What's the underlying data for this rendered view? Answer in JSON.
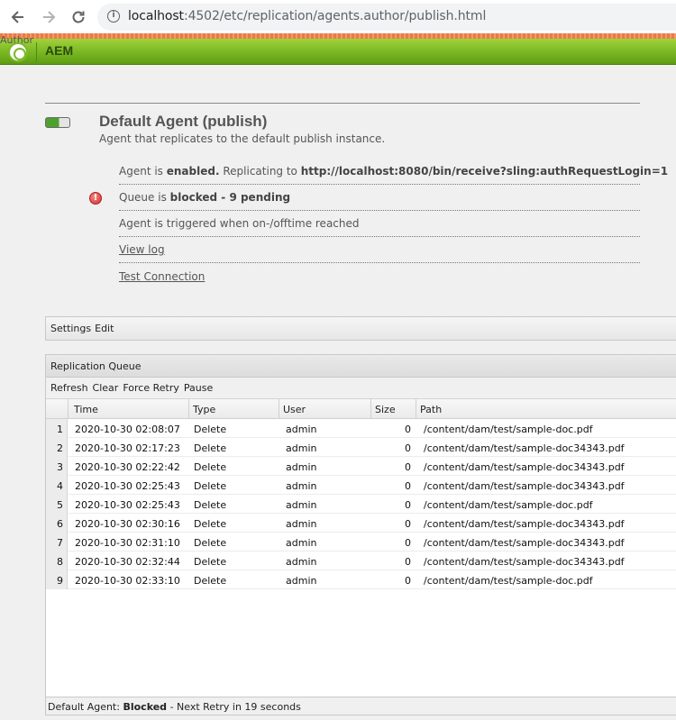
{
  "browser": {
    "url_host": "localhost",
    "url_rest": ":4502/etc/replication/agents.author/publish.html"
  },
  "header": {
    "author_label": "Author",
    "app_name": "AEM",
    "accent_color": "#7ab72b"
  },
  "agent": {
    "title": "Default Agent (publish)",
    "description": "Agent that replicates to the default publish instance.",
    "status_prefix": "Agent is",
    "status_value": "enabled.",
    "replicating_prefix": "Replicating to",
    "replicating_url": "http://localhost:8080/bin/receive?sling:authRequestLogin=1",
    "queue_prefix": "Queue is",
    "queue_value": "blocked - 9 pending",
    "trigger_text": "Agent is triggered when on-/offtime reached",
    "view_log": "View log",
    "test_connection": "Test Connection"
  },
  "settings": {
    "label": "Settings",
    "edit": "Edit"
  },
  "queue": {
    "title": "Replication Queue",
    "toolbar": {
      "refresh": "Refresh",
      "clear": "Clear",
      "force_retry": "Force Retry",
      "pause": "Pause"
    },
    "columns": {
      "time": "Time",
      "type": "Type",
      "user": "User",
      "size": "Size",
      "path": "Path"
    },
    "rows": [
      {
        "n": "1",
        "time": "2020-10-30 02:08:07",
        "type": "Delete",
        "user": "admin",
        "size": "0",
        "path": "/content/dam/test/sample-doc.pdf"
      },
      {
        "n": "2",
        "time": "2020-10-30 02:17:23",
        "type": "Delete",
        "user": "admin",
        "size": "0",
        "path": "/content/dam/test/sample-doc34343.pdf"
      },
      {
        "n": "3",
        "time": "2020-10-30 02:22:42",
        "type": "Delete",
        "user": "admin",
        "size": "0",
        "path": "/content/dam/test/sample-doc34343.pdf"
      },
      {
        "n": "4",
        "time": "2020-10-30 02:25:43",
        "type": "Delete",
        "user": "admin",
        "size": "0",
        "path": "/content/dam/test/sample-doc34343.pdf"
      },
      {
        "n": "5",
        "time": "2020-10-30 02:25:43",
        "type": "Delete",
        "user": "admin",
        "size": "0",
        "path": "/content/dam/test/sample-doc.pdf"
      },
      {
        "n": "6",
        "time": "2020-10-30 02:30:16",
        "type": "Delete",
        "user": "admin",
        "size": "0",
        "path": "/content/dam/test/sample-doc34343.pdf"
      },
      {
        "n": "7",
        "time": "2020-10-30 02:31:10",
        "type": "Delete",
        "user": "admin",
        "size": "0",
        "path": "/content/dam/test/sample-doc34343.pdf"
      },
      {
        "n": "8",
        "time": "2020-10-30 02:32:44",
        "type": "Delete",
        "user": "admin",
        "size": "0",
        "path": "/content/dam/test/sample-doc34343.pdf"
      },
      {
        "n": "9",
        "time": "2020-10-30 02:33:10",
        "type": "Delete",
        "user": "admin",
        "size": "0",
        "path": "/content/dam/test/sample-doc.pdf"
      }
    ],
    "status": {
      "agent": "Default Agent:",
      "state": "Blocked",
      "retry": "- Next Retry in 19 seconds"
    }
  }
}
